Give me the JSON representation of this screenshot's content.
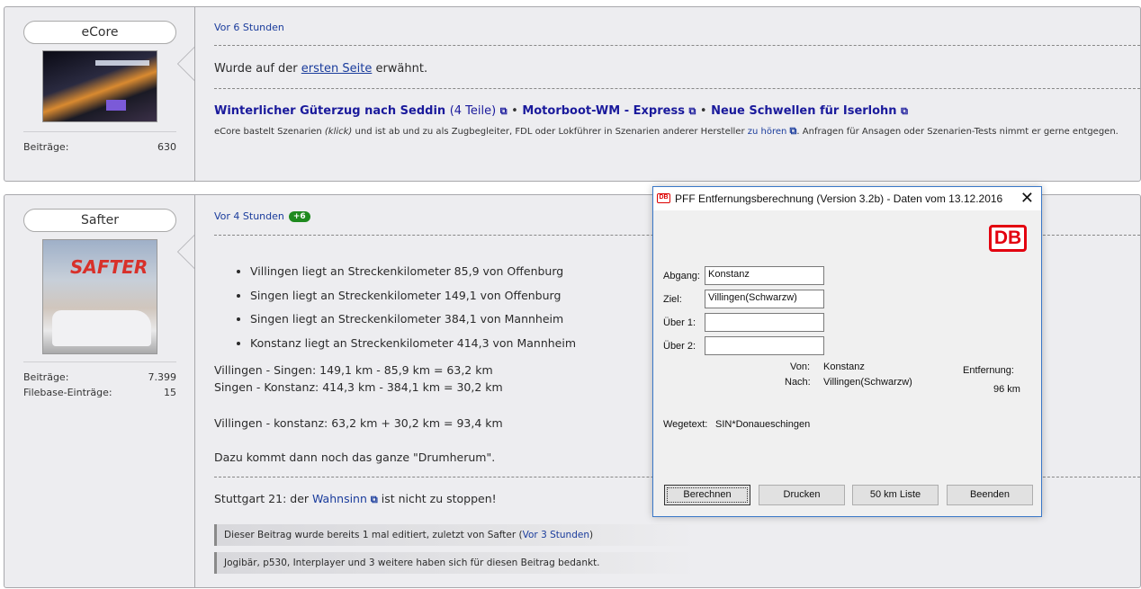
{
  "post1": {
    "username": "eCore",
    "stats": [
      {
        "label": "Beiträge:",
        "value": "630"
      }
    ],
    "time": "Vor 6 Stunden",
    "text_before": "Wurde auf der ",
    "link": "ersten Seite",
    "text_after": " erwähnt.",
    "signature": {
      "link1": "Winterlicher Güterzug nach Seddin",
      "link1_extra": "(4 Teile)",
      "separator": "•",
      "link2": "Motorboot-WM - Express",
      "link3": "Neue Schwellen für Iserlohn",
      "line2_a": "eCore bastelt Szenarien ",
      "line2_klick": "(klick)",
      "line2_b": " und ist ab und zu als Zugbegleiter, FDL oder Lokführer in Szenarien anderer Hersteller ",
      "line2_link": "zu hören",
      "line2_c": ". Anfragen für Ansagen oder Szenarien-Tests nimmt er gerne entgegen."
    }
  },
  "post2": {
    "username": "Safter",
    "avatar_text": "SAFTER",
    "stats": [
      {
        "label": "Beiträge:",
        "value": "7.399"
      },
      {
        "label": "Filebase-Einträge:",
        "value": "15"
      }
    ],
    "time": "Vor 4 Stunden",
    "badge": "+6",
    "list": [
      "Villingen liegt an Streckenkilometer 85,9 von Offenburg",
      "Singen liegt an Streckenkilometer 149,1 von Offenburg",
      "Singen liegt an Streckenkilometer 384,1 von Mannheim",
      "Konstanz liegt an Streckenkilometer 414,3 von Mannheim"
    ],
    "calc1": "Villingen - Singen: 149,1 km - 85,9 km = 63,2 km",
    "calc2": "Singen - Konstanz: 414,3 km - 384,1 km = 30,2 km",
    "calc3": "Villingen - konstanz: 63,2 km + 30,2 km = 93,4 km",
    "calc4": "Dazu kommt dann noch das ganze \"Drumherum\".",
    "stuttgart_a": "Stuttgart 21: der ",
    "stuttgart_link": "Wahnsinn",
    "stuttgart_b": " ist nicht zu stoppen!",
    "edit_note_a": "Dieser Beitrag wurde bereits 1 mal editiert, zuletzt von Safter (",
    "edit_note_link": "Vor 3 Stunden",
    "edit_note_b": ")",
    "thanks_note": "Jogibär, p530, Interplayer und 3 weitere haben sich für diesen Beitrag bedankt."
  },
  "dialog": {
    "icon_text": "DB",
    "title": "PFF Entfernungsberechnung (Version 3.2b) - Daten vom 13.12.2016",
    "close": "✕",
    "logo": "DB",
    "fields": [
      {
        "label": "Abgang:",
        "value": "Konstanz"
      },
      {
        "label": "Ziel:",
        "value": "Villingen(Schwarzw)"
      },
      {
        "label": "Über 1:",
        "value": ""
      },
      {
        "label": "Über 2:",
        "value": ""
      }
    ],
    "von_label": "Von:",
    "von_value": "Konstanz",
    "nach_label": "Nach:",
    "nach_value": "Villingen(Schwarzw)",
    "entfernung_label": "Entfernung:",
    "entfernung_value": "96 km",
    "wegetext_label": "Wegetext:",
    "wegetext_value": "SIN*Donaueschingen",
    "buttons": {
      "berechnen": "Berechnen",
      "drucken": "Drucken",
      "liste": "50 km Liste",
      "beenden": "Beenden"
    }
  }
}
